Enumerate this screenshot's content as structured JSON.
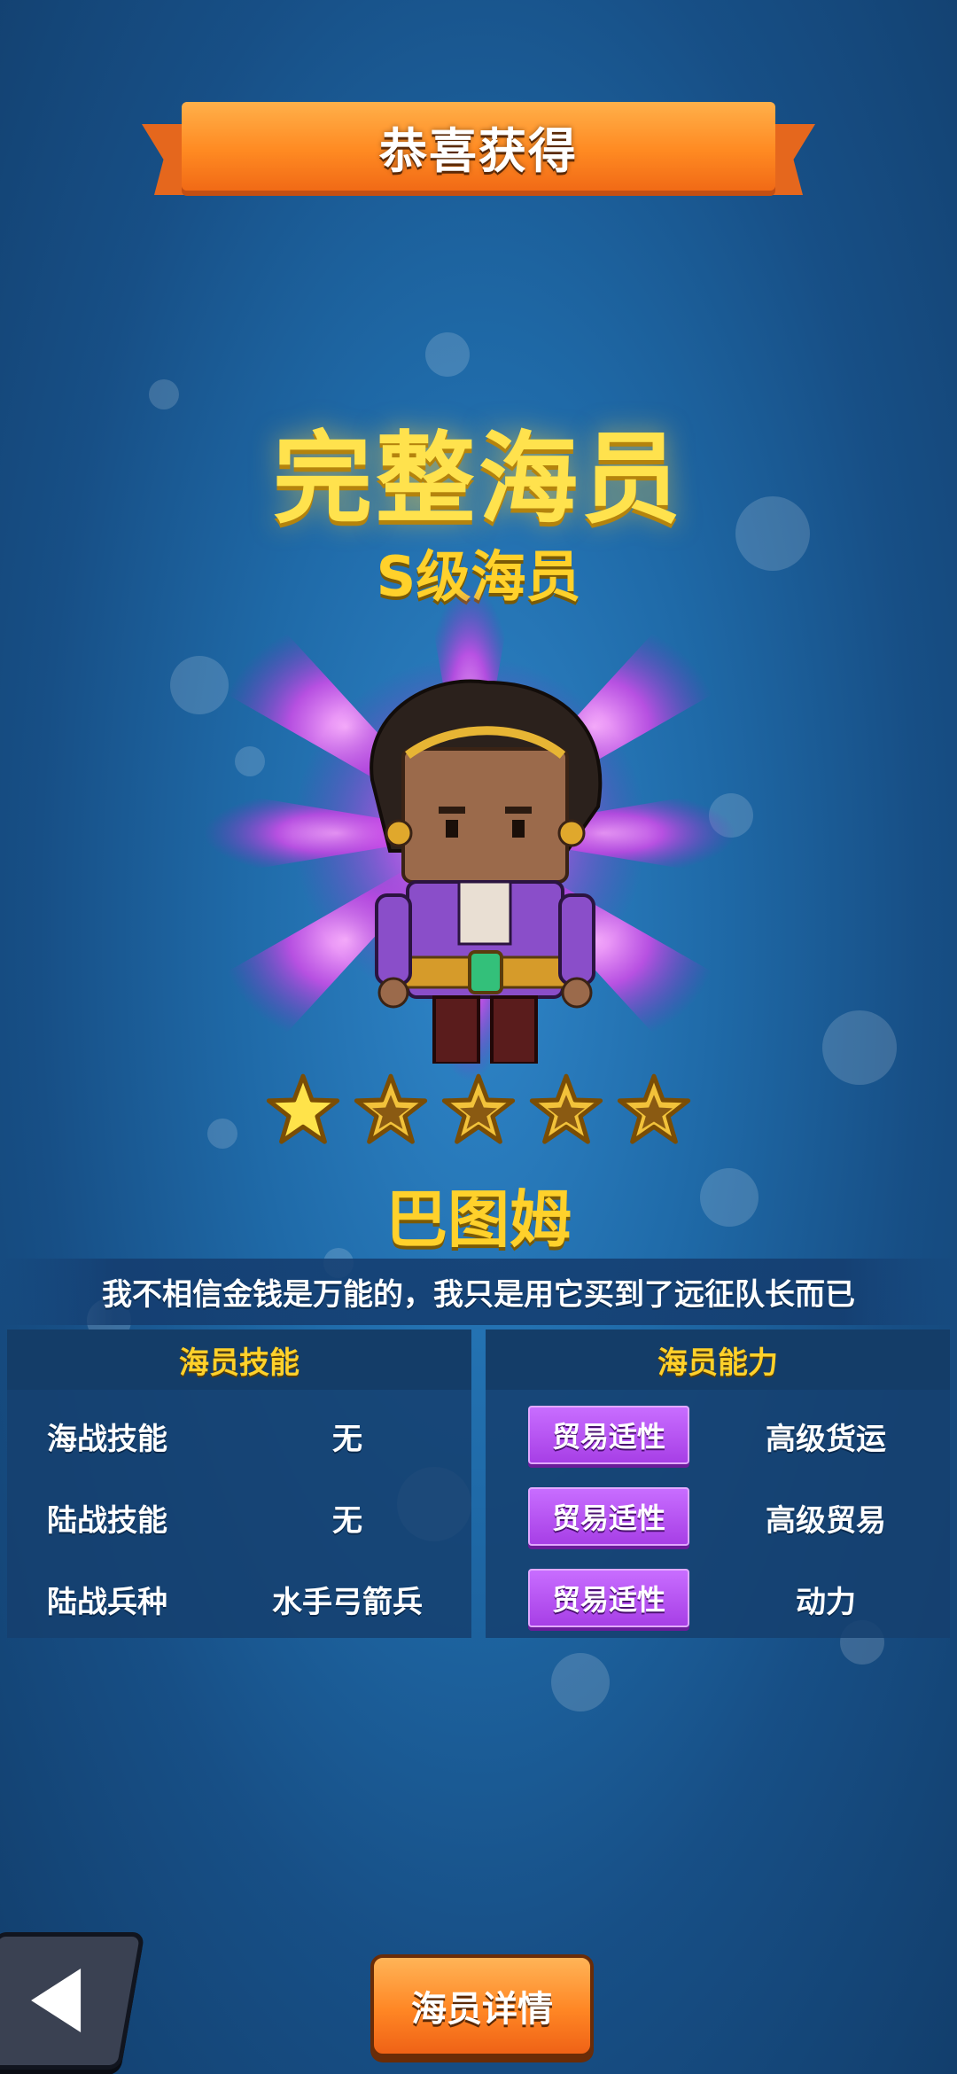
{
  "banner": {
    "title": "恭喜获得"
  },
  "reward": {
    "type_title": "完整海员",
    "grade": "S级海员",
    "stars_filled": 1,
    "stars_total": 5,
    "crew_name": "巴图姆",
    "quote": "我不相信金钱是万能的，我只是用它买到了远征队长而已"
  },
  "skills_panel": {
    "header": "海员技能",
    "rows": [
      {
        "label": "海战技能",
        "value": "无"
      },
      {
        "label": "陆战技能",
        "value": "无"
      },
      {
        "label": "陆战兵种",
        "value": "水手弓箭兵"
      }
    ]
  },
  "ability_panel": {
    "header": "海员能力",
    "rows": [
      {
        "tag": "贸易适性",
        "value": "高级货运"
      },
      {
        "tag": "贸易适性",
        "value": "高级贸易"
      },
      {
        "tag": "贸易适性",
        "value": "动力"
      }
    ]
  },
  "buttons": {
    "detail": "海员详情"
  },
  "colors": {
    "gold": "#ffd12b",
    "accent_orange": "#ff8a22",
    "tag_purple": "#b04fee",
    "bg_blue": "#1f6aa8"
  }
}
